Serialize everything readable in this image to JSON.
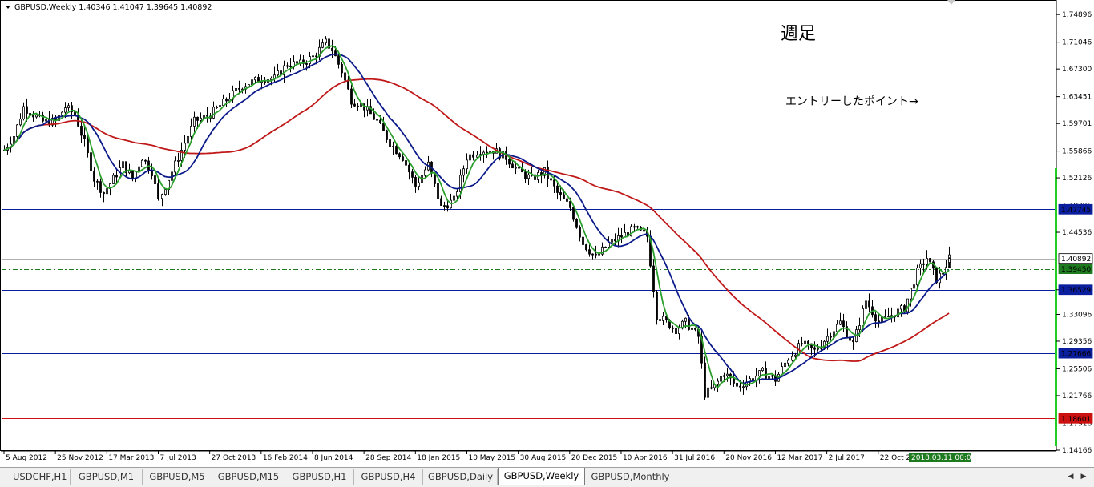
{
  "header": {
    "symbol_line": "GBPUSD,Weekly  1.40346 1.41047 1.39645 1.40892"
  },
  "annotations": {
    "title": "週足",
    "entry_label": "エントリーしたポイント→"
  },
  "price_axis": {
    "ticks": [
      "1.74896",
      "1.71046",
      "1.67300",
      "1.63451",
      "1.59701",
      "1.55866",
      "1.52126",
      "1.44536",
      "1.36529",
      "1.33096",
      "1.29356",
      "1.25506",
      "1.21766",
      "1.14166"
    ],
    "hidden_tick": "1.17916",
    "hidden_tick_2": "1.48296"
  },
  "price_tags": [
    {
      "value": "1.47745",
      "bg": "#0b1f9e",
      "fg": "#ffffff"
    },
    {
      "value": "1.40892",
      "bg": "#ffffff",
      "fg": "#000000"
    },
    {
      "value": "1.39450",
      "bg": "#1e7a1e",
      "fg": "#ffffff"
    },
    {
      "value": "1.36529",
      "bg": "#0b1f9e",
      "fg": "#ffffff"
    },
    {
      "value": "1.27666",
      "bg": "#0b1f9e",
      "fg": "#ffffff"
    },
    {
      "value": "1.18601",
      "bg": "#cc1111",
      "fg": "#ffffff"
    }
  ],
  "time_axis": {
    "labels": [
      "5 Aug 2012",
      "25 Nov 2012",
      "17 Mar 2013",
      "7 Jul 2013",
      "27 Oct 2013",
      "16 Feb 2014",
      "8 Jun 2014",
      "28 Sep 2014",
      "18 Jan 2015",
      "10 May 2015",
      "30 Aug 2015",
      "20 Dec 2015",
      "10 Apr 2016",
      "31 Jul 2016",
      "20 Nov 2016",
      "12 Mar 2017",
      "2 Jul 2017",
      "22 Oct 20"
    ],
    "cursor_label": "2018.03.11 00:00"
  },
  "tabs": [
    {
      "label": "USDCHF,H1",
      "active": false
    },
    {
      "label": "GBPUSD,M1",
      "active": false
    },
    {
      "label": "GBPUSD,M5",
      "active": false
    },
    {
      "label": "GBPUSD,M15",
      "active": false
    },
    {
      "label": "GBPUSD,H1",
      "active": false
    },
    {
      "label": "GBPUSD,H4",
      "active": false
    },
    {
      "label": "GBPUSD,Daily",
      "active": false
    },
    {
      "label": "GBPUSD,Weekly",
      "active": true
    },
    {
      "label": "GBPUSD,Monthly",
      "active": false
    }
  ],
  "colors": {
    "candle": "#000000",
    "ma_fast": "#2ca02c",
    "ma_mid": "#0b1a8a",
    "ma_slow": "#c01818",
    "hline_blue": "#0b1f9e",
    "hline_red": "#cc1111",
    "hline_green": "#1e7a1e",
    "cursor": "#1e7a1e"
  },
  "chart_data": {
    "type": "candlestick",
    "symbol": "GBPUSD",
    "timeframe": "Weekly",
    "last_bar": {
      "open": 1.40346,
      "high": 1.41047,
      "low": 1.39645,
      "close": 1.40892
    },
    "ylim": [
      1.14166,
      1.767
    ],
    "x_range": [
      "2012-08-05",
      "2018-03-25"
    ],
    "horizontal_levels": [
      {
        "value": 1.47745,
        "color": "blue"
      },
      {
        "value": 1.40892,
        "color": "gray"
      },
      {
        "value": 1.3945,
        "color": "green",
        "style": "dash-dot"
      },
      {
        "value": 1.36529,
        "color": "blue"
      },
      {
        "value": 1.27666,
        "color": "blue"
      },
      {
        "value": 1.18601,
        "color": "red"
      }
    ],
    "vertical_marker": {
      "date": "2018-03-11",
      "style": "dotted",
      "color": "green"
    },
    "price_path": [
      [
        "2012-08-05",
        1.56
      ],
      [
        "2012-08-26",
        1.58
      ],
      [
        "2012-09-16",
        1.62
      ],
      [
        "2012-10-07",
        1.61
      ],
      [
        "2012-10-28",
        1.6
      ],
      [
        "2012-11-25",
        1.6
      ],
      [
        "2012-12-16",
        1.62
      ],
      [
        "2013-01-06",
        1.61
      ],
      [
        "2013-01-27",
        1.57
      ],
      [
        "2013-02-17",
        1.52
      ],
      [
        "2013-03-10",
        1.5
      ],
      [
        "2013-03-31",
        1.52
      ],
      [
        "2013-04-21",
        1.54
      ],
      [
        "2013-05-12",
        1.52
      ],
      [
        "2013-06-02",
        1.55
      ],
      [
        "2013-06-23",
        1.53
      ],
      [
        "2013-07-07",
        1.49
      ],
      [
        "2013-07-28",
        1.52
      ],
      [
        "2013-08-25",
        1.56
      ],
      [
        "2013-09-22",
        1.6
      ],
      [
        "2013-10-27",
        1.61
      ],
      [
        "2013-12-01",
        1.63
      ],
      [
        "2014-01-05",
        1.65
      ],
      [
        "2014-02-16",
        1.66
      ],
      [
        "2014-03-16",
        1.66
      ],
      [
        "2014-04-13",
        1.68
      ],
      [
        "2014-05-11",
        1.68
      ],
      [
        "2014-06-08",
        1.69
      ],
      [
        "2014-07-06",
        1.71
      ],
      [
        "2014-07-20",
        1.7
      ],
      [
        "2014-08-10",
        1.67
      ],
      [
        "2014-08-31",
        1.63
      ],
      [
        "2014-09-28",
        1.62
      ],
      [
        "2014-10-26",
        1.6
      ],
      [
        "2014-11-23",
        1.57
      ],
      [
        "2014-12-21",
        1.55
      ],
      [
        "2015-01-18",
        1.51
      ],
      [
        "2015-02-15",
        1.54
      ],
      [
        "2015-03-15",
        1.48
      ],
      [
        "2015-04-12",
        1.49
      ],
      [
        "2015-05-10",
        1.55
      ],
      [
        "2015-06-07",
        1.56
      ],
      [
        "2015-07-05",
        1.56
      ],
      [
        "2015-08-02",
        1.55
      ],
      [
        "2015-08-30",
        1.53
      ],
      [
        "2015-09-27",
        1.52
      ],
      [
        "2015-10-25",
        1.53
      ],
      [
        "2015-11-22",
        1.5
      ],
      [
        "2015-12-20",
        1.48
      ],
      [
        "2016-01-17",
        1.43
      ],
      [
        "2016-02-14",
        1.41
      ],
      [
        "2016-03-13",
        1.43
      ],
      [
        "2016-04-10",
        1.44
      ],
      [
        "2016-05-08",
        1.45
      ],
      [
        "2016-06-05",
        1.44
      ],
      [
        "2016-06-26",
        1.33
      ],
      [
        "2016-07-17",
        1.32
      ],
      [
        "2016-08-07",
        1.31
      ],
      [
        "2016-08-28",
        1.32
      ],
      [
        "2016-09-25",
        1.3
      ],
      [
        "2016-10-09",
        1.22
      ],
      [
        "2016-10-30",
        1.23
      ],
      [
        "2016-11-20",
        1.25
      ],
      [
        "2016-12-18",
        1.23
      ],
      [
        "2017-01-15",
        1.24
      ],
      [
        "2017-02-12",
        1.25
      ],
      [
        "2017-03-12",
        1.24
      ],
      [
        "2017-04-09",
        1.27
      ],
      [
        "2017-05-07",
        1.29
      ],
      [
        "2017-06-04",
        1.28
      ],
      [
        "2017-07-02",
        1.3
      ],
      [
        "2017-07-30",
        1.32
      ],
      [
        "2017-08-27",
        1.29
      ],
      [
        "2017-09-24",
        1.35
      ],
      [
        "2017-10-22",
        1.32
      ],
      [
        "2017-11-19",
        1.33
      ],
      [
        "2017-12-17",
        1.34
      ],
      [
        "2018-01-14",
        1.39
      ],
      [
        "2018-02-04",
        1.41
      ],
      [
        "2018-02-25",
        1.38
      ],
      [
        "2018-03-11",
        1.39
      ],
      [
        "2018-03-25",
        1.40892
      ]
    ]
  }
}
